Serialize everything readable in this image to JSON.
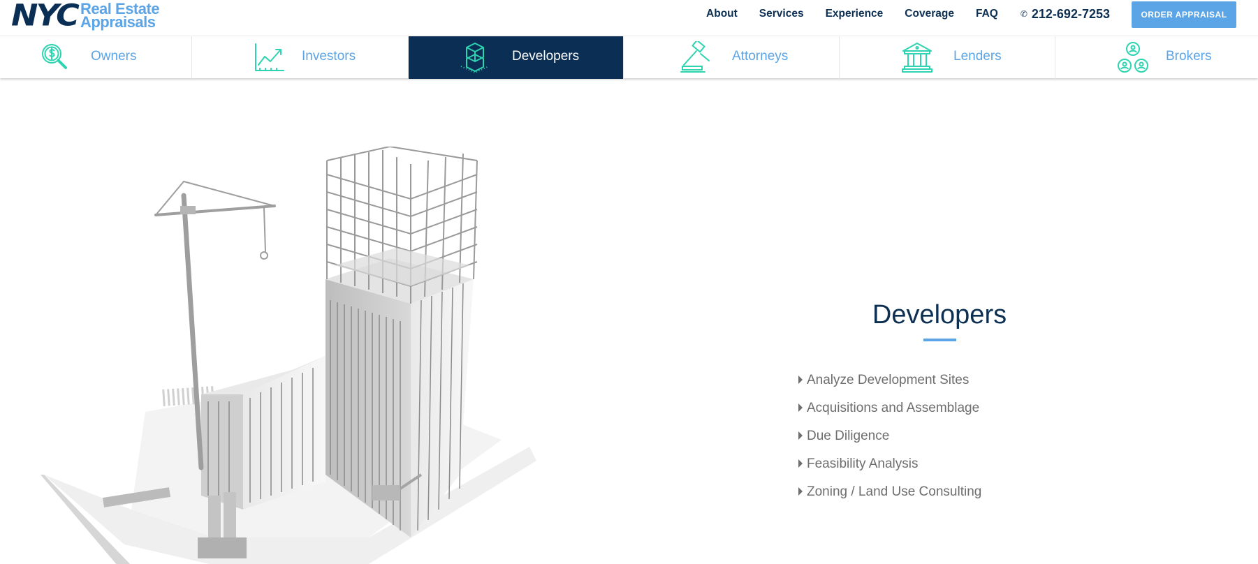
{
  "logo": {
    "mark": "NYC",
    "line1": "Real Estate",
    "line2": "Appraisals"
  },
  "nav": {
    "items": [
      "About",
      "Services",
      "Experience",
      "Coverage",
      "FAQ"
    ],
    "phone": "212-692-7253",
    "order_button": "ORDER APPRAISAL"
  },
  "tabs": [
    {
      "label": "Owners",
      "icon": "magnifier-dollar-icon",
      "active": false
    },
    {
      "label": "Investors",
      "icon": "growth-chart-icon",
      "active": false
    },
    {
      "label": "Developers",
      "icon": "cube-building-icon",
      "active": true
    },
    {
      "label": "Attorneys",
      "icon": "gavel-icon",
      "active": false
    },
    {
      "label": "Lenders",
      "icon": "bank-icon",
      "active": false
    },
    {
      "label": "Brokers",
      "icon": "people-network-icon",
      "active": false
    }
  ],
  "section": {
    "title": "Developers",
    "bullets": [
      "Analyze Development Sites",
      "Acquisitions and Assemblage",
      "Due Diligence",
      "Feasibility Analysis",
      "Zoning / Land Use Consulting"
    ]
  },
  "colors": {
    "navy": "#0b2e55",
    "accent_blue": "#5ba4e6",
    "icon_teal": "#2ed3b0",
    "bullet_gray": "#6d6d6d"
  }
}
